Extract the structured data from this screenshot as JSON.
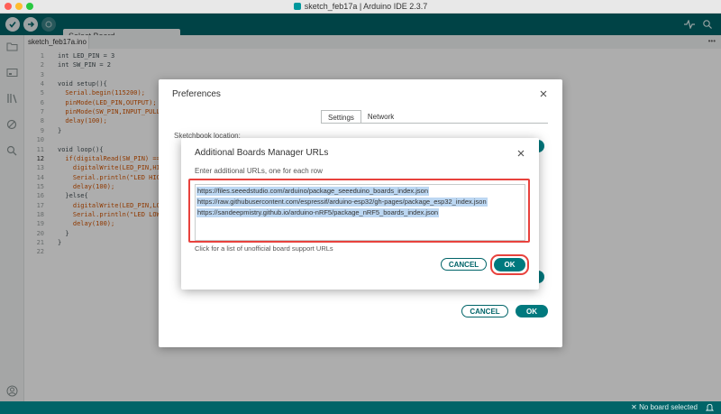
{
  "window": {
    "title": "sketch_feb17a | Arduino IDE 2.3.7",
    "traffic_colors": [
      "#ff5f57",
      "#febc2e",
      "#28c840"
    ]
  },
  "toolbar": {
    "board_select": "Select Board"
  },
  "editor": {
    "tab": "sketch_feb17a.ino",
    "active_line": "12",
    "lines": [
      {
        "n": "1",
        "text": "int LED_PIN = 3"
      },
      {
        "n": "2",
        "text": "int SW_PIN = 2"
      },
      {
        "n": "3",
        "text": ""
      },
      {
        "n": "4",
        "text": "void setup(){"
      },
      {
        "n": "5",
        "text": "  Serial.begin(115200);"
      },
      {
        "n": "6",
        "text": "  pinMode(LED_PIN,OUTPUT);"
      },
      {
        "n": "7",
        "text": "  pinMode(SW_PIN,INPUT_PULLU"
      },
      {
        "n": "8",
        "text": "  delay(100);"
      },
      {
        "n": "9",
        "text": "}"
      },
      {
        "n": "10",
        "text": ""
      },
      {
        "n": "11",
        "text": "void loop(){"
      },
      {
        "n": "12",
        "text": "  if(digitalRead(SW_PIN) =="
      },
      {
        "n": "13",
        "text": "    digitalWrite(LED_PIN,HIG"
      },
      {
        "n": "14",
        "text": "    Serial.println(\"LED HIGH"
      },
      {
        "n": "15",
        "text": "    delay(100);"
      },
      {
        "n": "16",
        "text": "  }else{"
      },
      {
        "n": "17",
        "text": "    digitalWrite(LED_PIN,LOW"
      },
      {
        "n": "18",
        "text": "    Serial.println(\"LED LOW\""
      },
      {
        "n": "19",
        "text": "    delay(100);"
      },
      {
        "n": "20",
        "text": "  }"
      },
      {
        "n": "21",
        "text": "}"
      },
      {
        "n": "22",
        "text": ""
      }
    ]
  },
  "status": {
    "text": "✕ No board selected"
  },
  "preferences": {
    "title": "Preferences",
    "tabs": [
      "Settings",
      "Network"
    ],
    "active_tab": "Settings",
    "sketchbook_label": "Sketchbook location:",
    "cancel": "CANCEL",
    "ok": "OK"
  },
  "boards_dialog": {
    "title": "Additional Boards Manager URLs",
    "prompt": "Enter additional URLs, one for each row",
    "urls": [
      "https://files.seeedstudio.com/arduino/package_seeeduino_boards_index.json",
      "https://raw.githubusercontent.com/espressif/arduino-esp32/gh-pages/package_esp32_index.json",
      "https://sandeepmistry.github.io/arduino-nRF5/package_nRF5_boards_index.json"
    ],
    "link": "Click for a list of unofficial board support URLs",
    "cancel": "CANCEL",
    "ok": "OK"
  },
  "colors": {
    "accent": "#006468",
    "button": "#00797e",
    "highlight_outline": "#e8423d",
    "selection": "#bcd7f2"
  }
}
